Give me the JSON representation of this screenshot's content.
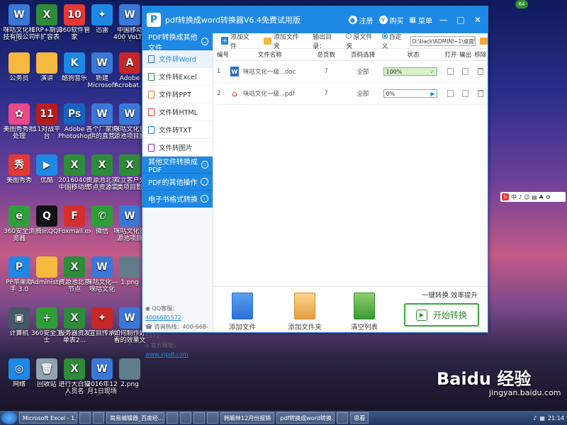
{
  "desktop": {
    "icons": [
      {
        "label": "咪咕文化科技有限公司最...",
        "color": "#3a78d8",
        "glyph": "W"
      },
      {
        "label": "ERP+期调半扩容表述...",
        "color": "#2e8b3a",
        "glyph": "X"
      },
      {
        "label": "360软件管家",
        "color": "#e53935",
        "glyph": "10"
      },
      {
        "label": "迅雷",
        "color": "#1e88e5",
        "glyph": "✦"
      },
      {
        "label": "中国移动400 VoLTE改造...",
        "color": "#3a78d8",
        "glyph": "W"
      },
      {
        "label": "公务员",
        "color": "#f4b93e",
        "glyph": ""
      },
      {
        "label": "演讲",
        "color": "#f4b93e",
        "glyph": ""
      },
      {
        "label": "酷狗音乐",
        "color": "#1e88e5",
        "glyph": "K"
      },
      {
        "label": "新建 Microsoft ...",
        "color": "#3a78d8",
        "glyph": "W"
      },
      {
        "label": "Adobe Acrobat...",
        "color": "#c62828",
        "glyph": "A"
      },
      {
        "label": "美图秀秀批处理",
        "color": "#e84a8a",
        "glyph": "✿"
      },
      {
        "label": "11对战平台",
        "color": "#b71c1c",
        "glyph": "11"
      },
      {
        "label": "Adobe Photoshop",
        "color": "#1565c0",
        "glyph": "Ps"
      },
      {
        "label": "各个厂家提供的直营机...",
        "color": "#3a78d8",
        "glyph": "W"
      },
      {
        "label": "咪咕文化资源池项目施工...",
        "color": "#3a78d8",
        "glyph": "W"
      },
      {
        "label": "美图秀秀",
        "color": "#e53935",
        "glyph": "秀"
      },
      {
        "label": "优酷",
        "color": "#1e88e5",
        "glyph": "▶"
      },
      {
        "label": "20160405中国移动故障...",
        "color": "#2e8b3a",
        "glyph": "X"
      },
      {
        "label": "资源池北京节点资源需求...",
        "color": "#2e8b3a",
        "glyph": "X"
      },
      {
        "label": "双立客户分类项目影响...",
        "color": "#2e8b3a",
        "glyph": "X"
      },
      {
        "label": "360安全浏览器",
        "color": "#2e9e3a",
        "glyph": "e"
      },
      {
        "label": "腾讯QQ",
        "color": "#111111",
        "glyph": "Q"
      },
      {
        "label": "Foxmail.exe",
        "color": "#d32f2f",
        "glyph": "F"
      },
      {
        "label": "微信",
        "color": "#2e9e3a",
        "glyph": "✆"
      },
      {
        "label": "咪咕文化资源池项目 201...",
        "color": "#3a78d8",
        "glyph": "W"
      },
      {
        "label": "PP苹果助手 3.0",
        "color": "#1e88e5",
        "glyph": "P"
      },
      {
        "label": "Administrator",
        "color": "#f4b93e",
        "glyph": ""
      },
      {
        "label": "资源池北京节点表.xlsx",
        "color": "#2e8b3a",
        "glyph": "X"
      },
      {
        "label": "咪咕文化—咪咕文化业...",
        "color": "#3a78d8",
        "glyph": "W"
      },
      {
        "label": "1.png",
        "color": "#607d8b",
        "glyph": ""
      },
      {
        "label": "计算机",
        "color": "#455a64",
        "glyph": "▣"
      },
      {
        "label": "360安全卫士",
        "color": "#2e9e3a",
        "glyph": "+"
      },
      {
        "label": "服务器资发单表2...",
        "color": "#2e8b3a",
        "glyph": "X"
      },
      {
        "label": "宣目传承",
        "color": "#c62828",
        "glyph": "✦"
      },
      {
        "label": "如何制作好看的效果文字",
        "color": "#3a78d8",
        "glyph": "W"
      },
      {
        "label": "网络",
        "color": "#1e88e5",
        "glyph": "◎"
      },
      {
        "label": "回收站",
        "color": "#90a4ae",
        "glyph": "🗑"
      },
      {
        "label": "进行大白猫人员名单.xlsx",
        "color": "#2e8b3a",
        "glyph": "X"
      },
      {
        "label": "2016年12月1日现场监...",
        "color": "#3a78d8",
        "glyph": "W"
      },
      {
        "label": "2.png",
        "color": "#607d8b",
        "glyph": ""
      }
    ],
    "badge": "64",
    "ime_text": "中 ♪ ☺ ▤ ♣ ⚙",
    "watermark": "Baidu 经验",
    "watermark_sub": "jingyan.baidu.com"
  },
  "window": {
    "title": "pdf转换成word转换器V6.4免费试用版",
    "logo": "P",
    "register": "注册",
    "buy": "购买",
    "menu": "菜单",
    "minimize": "—",
    "maximize": "□",
    "close": "✕"
  },
  "sidebar": {
    "categories": [
      {
        "label": "PDF转换成其他文件",
        "arrow": "⌄"
      },
      {
        "label": "其他文件转换成PDF",
        "arrow": "›"
      },
      {
        "label": "PDF的其他操作",
        "arrow": "›"
      },
      {
        "label": "电子书格式转换",
        "arrow": "›"
      }
    ],
    "items": [
      {
        "label": "文件转Word",
        "color": "#2b6fd6"
      },
      {
        "label": "文件转Excel",
        "color": "#2e8b3a"
      },
      {
        "label": "文件转PPT",
        "color": "#e07b2e"
      },
      {
        "label": "文件转HTML",
        "color": "#e53935"
      },
      {
        "label": "文件转TXT",
        "color": "#1e88e5"
      },
      {
        "label": "文件转图片",
        "color": "#8e24aa"
      }
    ],
    "qq_label": "QQ客服：",
    "qq_value": "4006685572",
    "hotline_label": "咨询热线：",
    "hotline_value": "400-668-5572",
    "site_label": "官方网址：",
    "site_value": "www.xjpdf.com"
  },
  "toolbar": {
    "add_file": "添加文件",
    "add_folder": "添加文件夹",
    "output_label": "输出目录：",
    "original_folder": "原文件夹",
    "custom": "自定义",
    "path_value": "D:\\back\\ADMINI~1\\桌面\\"
  },
  "table": {
    "headers": [
      "编号",
      "文件名称",
      "总页数",
      "页码选择",
      "状态",
      "打开",
      "输出",
      "移除"
    ],
    "rows": [
      {
        "no": "1",
        "type": "W",
        "name": "咪咕文化一级...doc",
        "pages": "7",
        "range": "全部",
        "progress_text": "100%",
        "progress": 1.0,
        "mark": "✓"
      },
      {
        "no": "2",
        "type": "PDF",
        "name": "咪咕文化一级...pdf",
        "pages": "7",
        "range": "全部",
        "progress_text": "0%",
        "progress": 0.0,
        "mark": "▶"
      }
    ]
  },
  "bottom": {
    "add_file": "添加文件",
    "add_folder": "添加文件夹",
    "clear_list": "清空列表",
    "hint": "一键转换 效率提升",
    "start": "开始转换"
  },
  "taskbar": {
    "items": [
      "Microsoft Excel - 1...",
      "",
      "",
      "简易编辑器_百度经...",
      "",
      "",
      "",
      "",
      "韩颖林12月份报销",
      "pdf转换成word转换...",
      "",
      "思看"
    ],
    "clock": "21:14"
  }
}
